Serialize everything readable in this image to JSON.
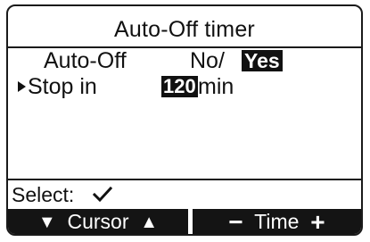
{
  "screen": {
    "title": "Auto-Off timer"
  },
  "settings": {
    "auto_off": {
      "label": "Auto-Off",
      "option_no": "No/",
      "option_yes": "Yes",
      "selected": "Yes"
    },
    "stop_in": {
      "label": "Stop in",
      "value": "120",
      "unit": "min",
      "cursor_icon": "right-triangle-icon"
    }
  },
  "footer": {
    "select_label": "Select:",
    "select_icon": "checkmark-icon",
    "softkeys": {
      "cursor_down_icon": "▼",
      "cursor_label": "Cursor",
      "cursor_up_icon": "▲",
      "time_minus_icon": "−",
      "time_label": "Time",
      "time_plus_icon": "+"
    }
  },
  "colors": {
    "foreground": "#111111",
    "background": "#ffffff",
    "highlight_bg": "#111111",
    "highlight_fg": "#ffffff"
  }
}
